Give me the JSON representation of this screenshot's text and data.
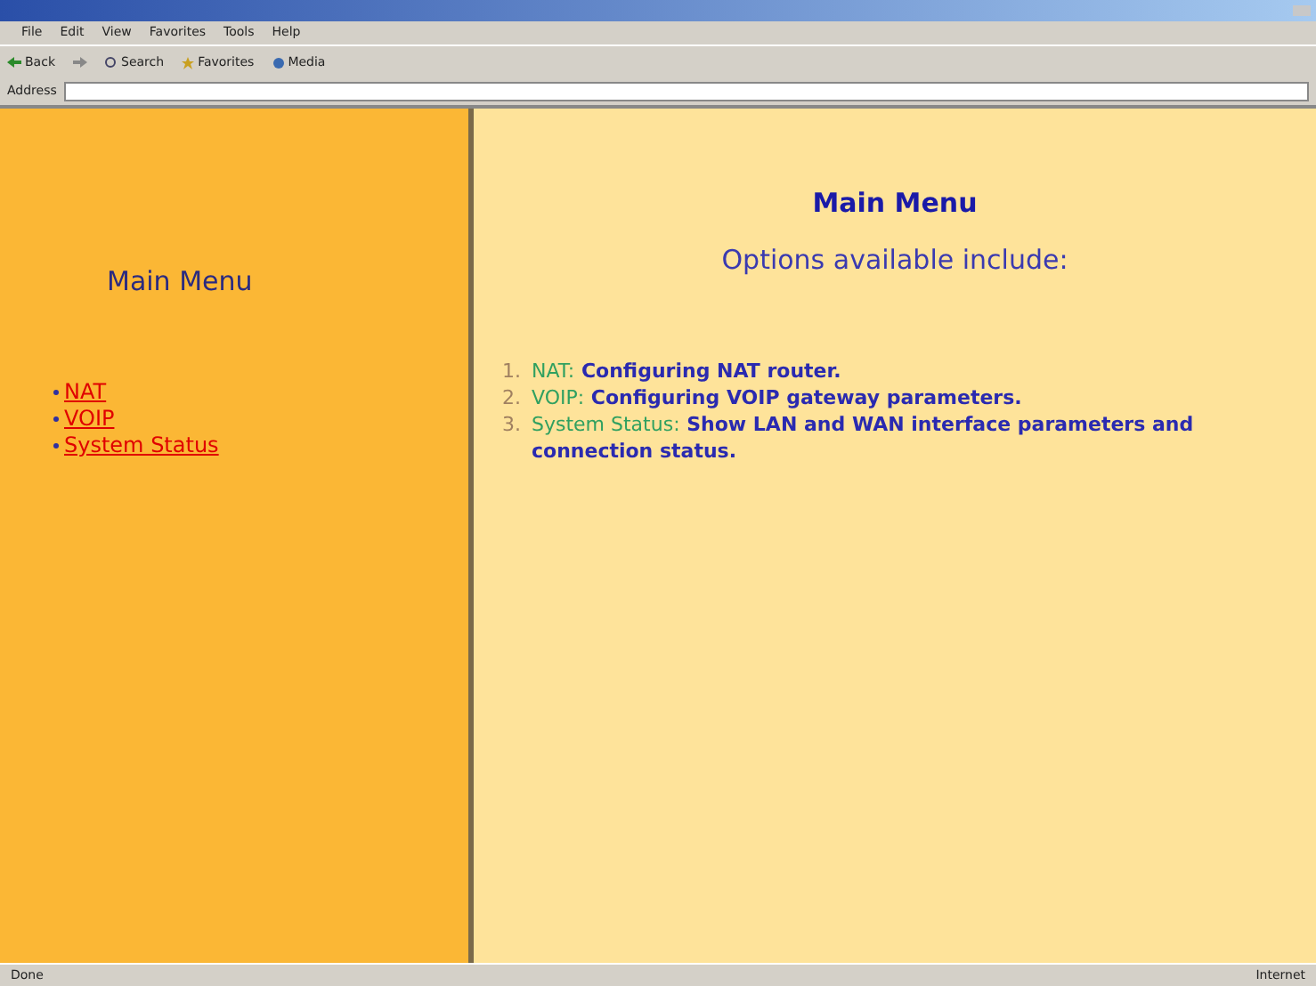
{
  "menu_bar": [
    "File",
    "Edit",
    "View",
    "Favorites",
    "Tools",
    "Help"
  ],
  "toolbar": [
    {
      "label": "Back",
      "kind": "back"
    },
    {
      "kind": "forward"
    },
    {
      "label": "Search",
      "kind": "search"
    },
    {
      "label": "Favorites",
      "kind": "favorites"
    },
    {
      "label": "Media",
      "kind": "media"
    }
  ],
  "address_bar": {
    "label": "Address"
  },
  "sidebar": {
    "title": "Main Menu",
    "links": [
      "NAT",
      "VOIP",
      "System Status"
    ]
  },
  "content": {
    "title": "Main Menu",
    "subtitle": "Options available include:",
    "options": [
      {
        "number": "1.",
        "name": "NAT:",
        "description": "Configuring NAT router."
      },
      {
        "number": "2.",
        "name": "VOIP:",
        "description": "Configuring VOIP gateway parameters."
      },
      {
        "number": "3.",
        "name": "System Status:",
        "description": "Show LAN and WAN interface parameters and connection status."
      }
    ]
  },
  "status_bar": {
    "status": "Done",
    "zone": "Internet"
  }
}
